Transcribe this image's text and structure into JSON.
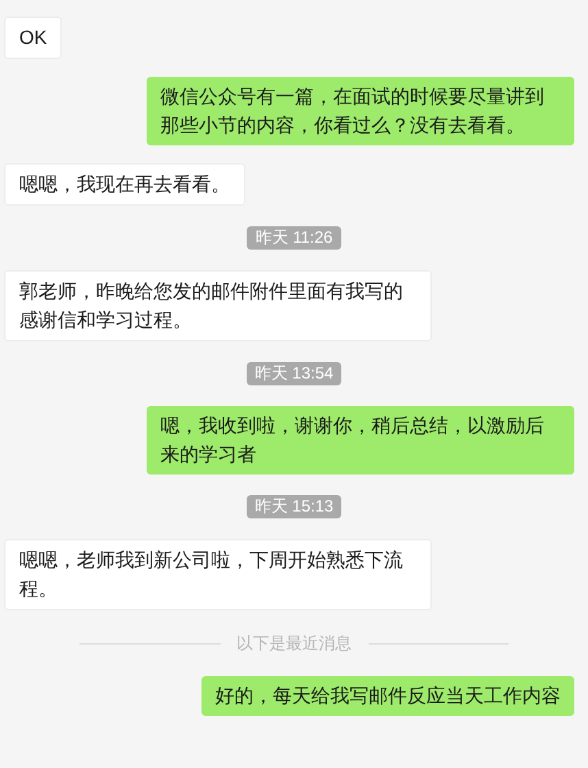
{
  "messages": [
    {
      "kind": "incoming",
      "text": "OK"
    },
    {
      "kind": "outgoing",
      "text": "微信公众号有一篇，在面试的时候要尽量讲到那些小节的内容，你看过么？没有去看看。"
    },
    {
      "kind": "incoming",
      "text": "嗯嗯，我现在再去看看。"
    },
    {
      "kind": "time",
      "text": "昨天 11:26"
    },
    {
      "kind": "incoming",
      "text": "郭老师，昨晚给您发的邮件附件里面有我写的感谢信和学习过程。"
    },
    {
      "kind": "time",
      "text": "昨天 13:54"
    },
    {
      "kind": "outgoing",
      "text": "嗯，我收到啦，谢谢你，稍后总结，以激励后来的学习者"
    },
    {
      "kind": "time",
      "text": "昨天 15:13"
    },
    {
      "kind": "incoming",
      "text": "嗯嗯，老师我到新公司啦，下周开始熟悉下流程。"
    },
    {
      "kind": "divider",
      "text": "以下是最近消息"
    },
    {
      "kind": "outgoing",
      "text": "好的，每天给我写邮件反应当天工作内容"
    }
  ]
}
